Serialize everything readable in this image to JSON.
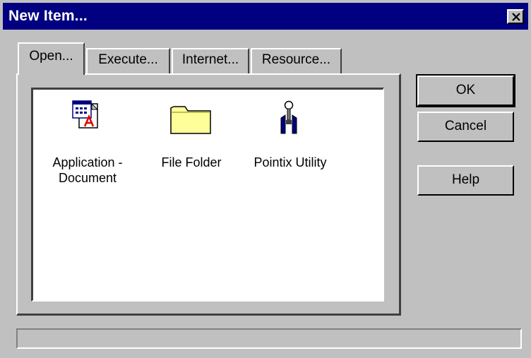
{
  "window": {
    "title": "New Item..."
  },
  "tabs": [
    {
      "label": "Open...",
      "active": true
    },
    {
      "label": "Execute...",
      "active": false
    },
    {
      "label": "Internet...",
      "active": false
    },
    {
      "label": "Resource...",
      "active": false
    }
  ],
  "items": [
    {
      "label": "Application - Document",
      "icon": "application-document-icon"
    },
    {
      "label": "File Folder",
      "icon": "folder-icon"
    },
    {
      "label": "Pointix Utility",
      "icon": "utility-icon"
    }
  ],
  "buttons": {
    "ok": "OK",
    "cancel": "Cancel",
    "help": "Help"
  },
  "status": {
    "text": ""
  },
  "colors": {
    "face": "#c0c0c0",
    "titlebar": "#000080",
    "folder": "#ffff99"
  }
}
